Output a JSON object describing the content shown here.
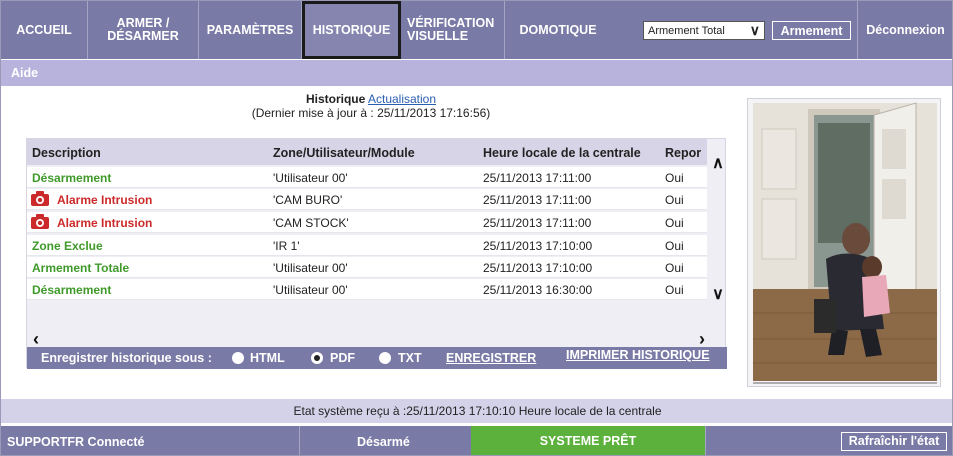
{
  "nav": {
    "items": [
      {
        "label": "ACCUEIL"
      },
      {
        "label": "ARMER /\nDÉSARMER"
      },
      {
        "label": "PARAMÈTRES"
      },
      {
        "label": "HISTORIQUE"
      },
      {
        "label": "VÉRIFICATION\nVISUELLE"
      },
      {
        "label": "DOMOTIQUE"
      }
    ],
    "arm_select_value": "Armement Total",
    "arm_button": "Armement",
    "logout": "Déconnexion"
  },
  "aide": "Aide",
  "history": {
    "title": "Historique",
    "refresh_link": "Actualisation",
    "last_update": "(Dernier mise à jour à : 25/11/2013 17:16:56)",
    "columns": [
      "Description",
      "Zone/Utilisateur/Module",
      "Heure locale de la centrale",
      "Repor"
    ],
    "rows": [
      {
        "description": "Désarmement",
        "status": "green",
        "zone": "'Utilisateur 00'",
        "time": "25/11/2013 17:11:00",
        "report": "Oui",
        "icon": ""
      },
      {
        "description": "Alarme Intrusion",
        "status": "red",
        "zone": "'CAM BURO'",
        "time": "25/11/2013 17:11:00",
        "report": "Oui",
        "icon": "camera-icon"
      },
      {
        "description": "Alarme Intrusion",
        "status": "red",
        "zone": "'CAM STOCK'",
        "time": "25/11/2013 17:11:00",
        "report": "Oui",
        "icon": "camera-icon"
      },
      {
        "description": "Zone Exclue",
        "status": "green",
        "zone": "'IR 1'",
        "time": "25/11/2013 17:10:00",
        "report": "Oui",
        "icon": ""
      },
      {
        "description": "Armement Totale",
        "status": "green",
        "zone": "'Utilisateur 00'",
        "time": "25/11/2013 17:10:00",
        "report": "Oui",
        "icon": ""
      },
      {
        "description": "Désarmement",
        "status": "green",
        "zone": "'Utilisateur 00'",
        "time": "25/11/2013 16:30:00",
        "report": "Oui",
        "icon": ""
      }
    ]
  },
  "save": {
    "label": "Enregistrer historique sous :",
    "formats": [
      {
        "label": "HTML",
        "selected": false
      },
      {
        "label": "PDF",
        "selected": true
      },
      {
        "label": "TXT",
        "selected": false
      }
    ],
    "save_link": "ENREGISTRER",
    "print_link": "IMPRIMER HISTORIQUE"
  },
  "status_line": "Etat système reçu à :25/11/2013 17:10:10 Heure locale de la centrale",
  "bottom": {
    "connection": "SUPPORTFR Connecté",
    "state": "Désarmé",
    "system": "SYSTEME PRÊT",
    "refresh_button": "Rafraîchir l'état"
  },
  "colors": {
    "nav_bg": "#7a7aa6",
    "aide_bg": "#b7b3dc",
    "green": "#3f9a2a",
    "red": "#cc2a2a",
    "ready_bg": "#5cb03c"
  }
}
